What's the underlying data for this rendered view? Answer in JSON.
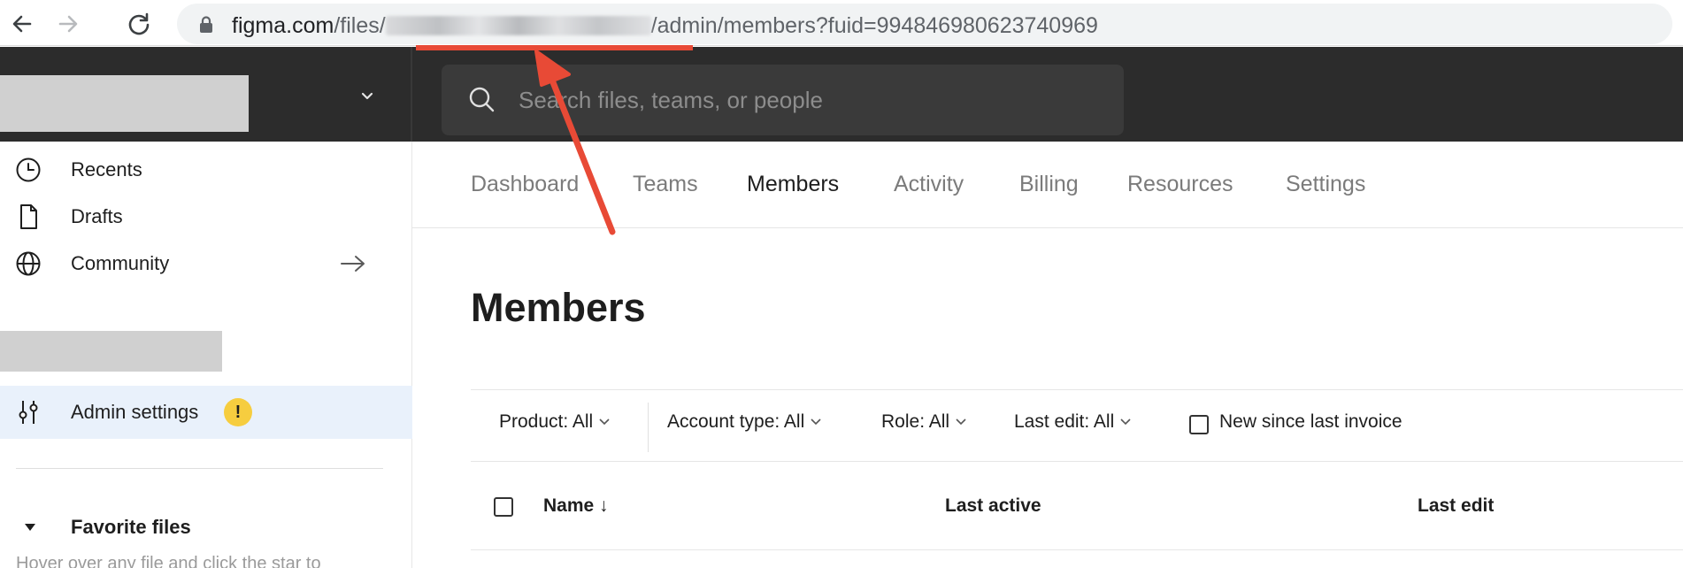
{
  "browser": {
    "back_icon": "arrow-left-icon",
    "forward_icon": "arrow-right-icon",
    "reload_icon": "reload-icon",
    "lock_icon": "lock-icon",
    "url_host": "figma.com",
    "url_path_prefix": "/files/",
    "url_path_suffix": "/admin/members?fuid=994846980623740969"
  },
  "topbar": {
    "org_caret_icon": "chevron-down-icon",
    "search_icon": "search-icon",
    "search_placeholder": "Search files, teams, or people"
  },
  "sidebar": {
    "items": [
      {
        "label": "Recents",
        "icon": "clock-icon"
      },
      {
        "label": "Drafts",
        "icon": "file-icon"
      },
      {
        "label": "Community",
        "icon": "globe-icon",
        "trailing_icon": "arrow-right-icon"
      },
      {
        "label": "Admin settings",
        "icon": "sliders-icon",
        "badge": "!"
      }
    ],
    "favorites_title": "Favorite files",
    "favorites_hint": "Hover over any file and click the star to"
  },
  "main": {
    "tabs": [
      {
        "label": "Dashboard"
      },
      {
        "label": "Teams"
      },
      {
        "label": "Members"
      },
      {
        "label": "Activity"
      },
      {
        "label": "Billing"
      },
      {
        "label": "Resources"
      },
      {
        "label": "Settings"
      }
    ],
    "active_tab": "Members",
    "page_title": "Members",
    "filters": [
      {
        "label": "Product: All"
      },
      {
        "label": "Account type: All"
      },
      {
        "label": "Role: All"
      },
      {
        "label": "Last edit: All"
      }
    ],
    "new_since_invoice_label": "New since last invoice",
    "table_headers": {
      "name": "Name ↓",
      "last_active": "Last active",
      "last_edit": "Last edit"
    }
  },
  "annotation": {
    "color": "#e84a36"
  }
}
